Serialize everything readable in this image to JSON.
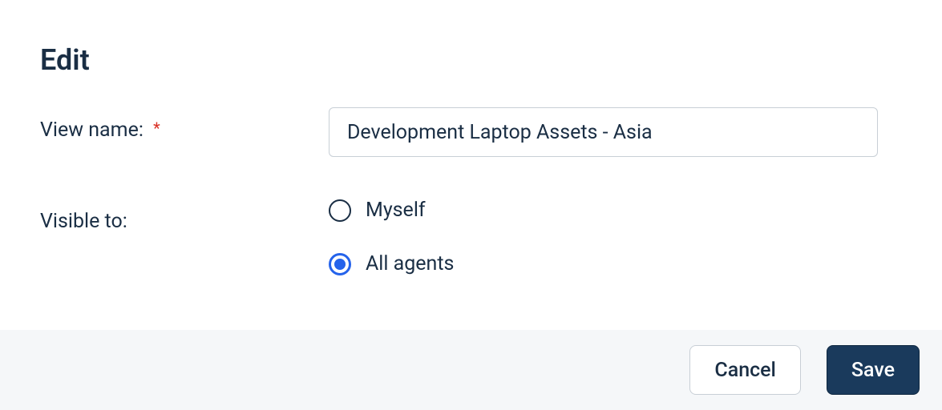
{
  "heading": "Edit",
  "form": {
    "viewName": {
      "label": "View name:",
      "required": "*",
      "value": "Development Laptop Assets - Asia"
    },
    "visibleTo": {
      "label": "Visible to:",
      "options": [
        {
          "label": "Myself",
          "selected": false
        },
        {
          "label": "All agents",
          "selected": true
        }
      ]
    }
  },
  "buttons": {
    "cancel": "Cancel",
    "save": "Save"
  }
}
